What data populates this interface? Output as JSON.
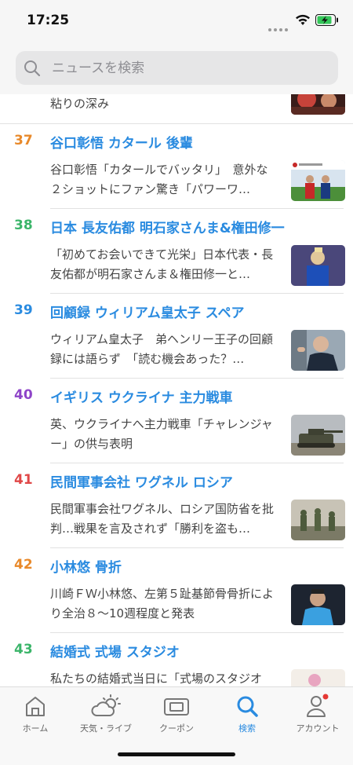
{
  "status_bar": {
    "time": "17:25"
  },
  "search": {
    "placeholder": "ニュースを検索"
  },
  "partial_item": {
    "desc": "粘りの深み"
  },
  "news": [
    {
      "rank": "37",
      "rank_color": "#e8892a",
      "title": "谷口彰悟 カタール 後輩",
      "desc": "谷口彰悟「カタールでバッタリ」　意外な２ショットにファン驚き「パワーワ…"
    },
    {
      "rank": "38",
      "rank_color": "#3bb56a",
      "title": "日本 長友佑都 明石家さんま&権田修一",
      "desc": "「初めてお会いできて光栄」日本代表・長友佑都が明石家さんま＆権田修一と…"
    },
    {
      "rank": "39",
      "rank_color": "#2a8be0",
      "title": "回顧録 ウィリアム皇太子 スペア",
      "desc": "ウィリアム皇太子　弟ヘンリー王子の回顧録には語らず　「読む機会あった？…"
    },
    {
      "rank": "40",
      "rank_color": "#8e44c8",
      "title": "イギリス ウクライナ 主力戦車",
      "desc": "英、ウクライナへ主力戦車「チャレンジャー」の供与表明"
    },
    {
      "rank": "41",
      "rank_color": "#e04848",
      "title": "民間軍事会社 ワグネル ロシア",
      "desc": "民間軍事会社ワグネル、ロシア国防省を批判…戦果を言及されず「勝利を盗も…"
    },
    {
      "rank": "42",
      "rank_color": "#e8892a",
      "title": "小林悠 骨折",
      "desc": "川崎ＦＷ小林悠、左第５趾基節骨骨折により全治８〜10週程度と発表"
    },
    {
      "rank": "43",
      "rank_color": "#3bb56a",
      "title": "結婚式 式場 スタジオ",
      "desc": "私たちの結婚式当日に「式場のスタジオ"
    }
  ],
  "tabbar": {
    "tabs": [
      {
        "label": "ホーム",
        "icon": "home-icon",
        "active": false
      },
      {
        "label": "天気・ライブ",
        "icon": "weather-icon",
        "active": false
      },
      {
        "label": "クーポン",
        "icon": "coupon-icon",
        "active": false
      },
      {
        "label": "検索",
        "icon": "search-icon",
        "active": true
      },
      {
        "label": "アカウント",
        "icon": "account-icon",
        "active": false
      }
    ],
    "accent_color": "#2a8be0",
    "badge_color": "#e53935"
  }
}
